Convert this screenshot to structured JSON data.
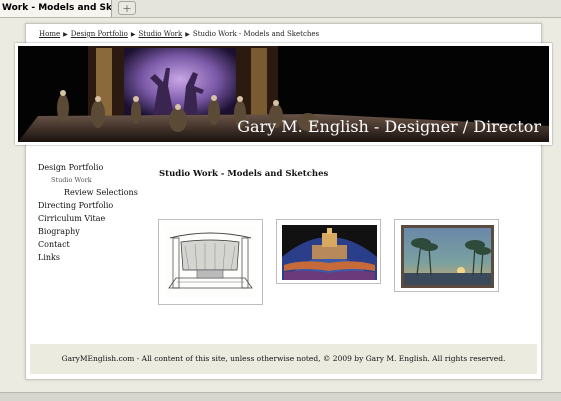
{
  "browser": {
    "tab_title": "Work - Models and Sketches",
    "new_tab_glyph": "+"
  },
  "breadcrumb": {
    "items": [
      "Home",
      "Design Portfolio",
      "Studio Work",
      "Studio Work - Models and Sketches"
    ],
    "separator": "▶"
  },
  "banner": {
    "title": "Gary M. English - Designer / Director"
  },
  "nav": {
    "items": [
      {
        "label": "Design Portfolio"
      },
      {
        "label": "Studio Work"
      },
      {
        "label": "Review Selections"
      },
      {
        "label": "Directing Portfolio"
      },
      {
        "label": "Cirriculum Vitae"
      },
      {
        "label": "Biography"
      },
      {
        "label": "Contact"
      },
      {
        "label": "Links"
      }
    ]
  },
  "main": {
    "heading": "Studio Work - Models and Sketches"
  },
  "footer": {
    "text": "GaryMEnglish.com - All content of this site, unless otherwise noted, © 2009 by Gary M. English. All rights reserved."
  }
}
